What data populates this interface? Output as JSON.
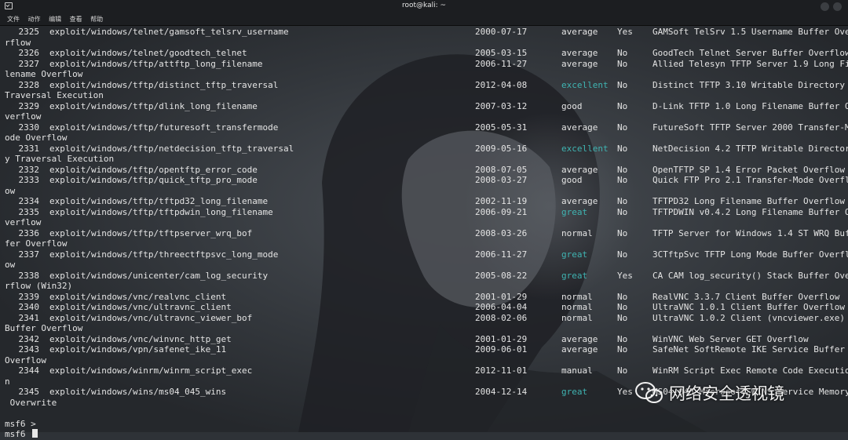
{
  "window": {
    "title": "root@kali: ~"
  },
  "menu": [
    "文件",
    "动作",
    "编辑",
    "查看",
    "帮助"
  ],
  "rows": [
    {
      "num": "2325",
      "path": "exploit/windows/telnet/gamsoft_telsrv_username",
      "date": "2000-07-17",
      "rank": "average",
      "check": "Yes",
      "desc": "GAMSoft TelSrv 1.5 Username Buffer Ove",
      "wrap": "rflow"
    },
    {
      "num": "2326",
      "path": "exploit/windows/telnet/goodtech_telnet",
      "date": "2005-03-15",
      "rank": "average",
      "check": "No",
      "desc": "GoodTech Telnet Server Buffer Overflow",
      "wrap": ""
    },
    {
      "num": "2327",
      "path": "exploit/windows/tftp/attftp_long_filename",
      "date": "2006-11-27",
      "rank": "average",
      "check": "No",
      "desc": "Allied Telesyn TFTP Server 1.9 Long Fi",
      "wrap": "lename Overflow"
    },
    {
      "num": "2328",
      "path": "exploit/windows/tftp/distinct_tftp_traversal",
      "date": "2012-04-08",
      "rank": "excellent",
      "check": "No",
      "desc": "Distinct TFTP 3.10 Writable Directory",
      "wrap": "Traversal Execution"
    },
    {
      "num": "2329",
      "path": "exploit/windows/tftp/dlink_long_filename",
      "date": "2007-03-12",
      "rank": "good",
      "check": "No",
      "desc": "D-Link TFTP 1.0 Long Filename Buffer O",
      "wrap": "verflow"
    },
    {
      "num": "2330",
      "path": "exploit/windows/tftp/futuresoft_transfermode",
      "date": "2005-05-31",
      "rank": "average",
      "check": "No",
      "desc": "FutureSoft TFTP Server 2000 Transfer-M",
      "wrap": "ode Overflow"
    },
    {
      "num": "2331",
      "path": "exploit/windows/tftp/netdecision_tftp_traversal",
      "date": "2009-05-16",
      "rank": "excellent",
      "check": "No",
      "desc": "NetDecision 4.2 TFTP Writable Director",
      "wrap": "y Traversal Execution"
    },
    {
      "num": "2332",
      "path": "exploit/windows/tftp/opentftp_error_code",
      "date": "2008-07-05",
      "rank": "average",
      "check": "No",
      "desc": "OpenTFTP SP 1.4 Error Packet Overflow",
      "wrap": ""
    },
    {
      "num": "2333",
      "path": "exploit/windows/tftp/quick_tftp_pro_mode",
      "date": "2008-03-27",
      "rank": "good",
      "check": "No",
      "desc": "Quick FTP Pro 2.1 Transfer-Mode Overfl",
      "wrap": "ow"
    },
    {
      "num": "2334",
      "path": "exploit/windows/tftp/tftpd32_long_filename",
      "date": "2002-11-19",
      "rank": "average",
      "check": "No",
      "desc": "TFTPD32 Long Filename Buffer Overflow",
      "wrap": ""
    },
    {
      "num": "2335",
      "path": "exploit/windows/tftp/tftpdwin_long_filename",
      "date": "2006-09-21",
      "rank": "great",
      "check": "No",
      "desc": "TFTPDWIN v0.4.2 Long Filename Buffer O",
      "wrap": "verflow"
    },
    {
      "num": "2336",
      "path": "exploit/windows/tftp/tftpserver_wrq_bof",
      "date": "2008-03-26",
      "rank": "normal",
      "check": "No",
      "desc": "TFTP Server for Windows 1.4 ST WRQ Buf",
      "wrap": "fer Overflow"
    },
    {
      "num": "2337",
      "path": "exploit/windows/tftp/threectftpsvc_long_mode",
      "date": "2006-11-27",
      "rank": "great",
      "check": "No",
      "desc": "3CTftpSvc TFTP Long Mode Buffer Overfl",
      "wrap": "ow"
    },
    {
      "num": "2338",
      "path": "exploit/windows/unicenter/cam_log_security",
      "date": "2005-08-22",
      "rank": "great",
      "check": "Yes",
      "desc": "CA CAM log_security() Stack Buffer Ove",
      "wrap": "rflow (Win32)"
    },
    {
      "num": "2339",
      "path": "exploit/windows/vnc/realvnc_client",
      "date": "2001-01-29",
      "rank": "normal",
      "check": "No",
      "desc": "RealVNC 3.3.7 Client Buffer Overflow",
      "wrap": ""
    },
    {
      "num": "2340",
      "path": "exploit/windows/vnc/ultravnc_client",
      "date": "2006-04-04",
      "rank": "normal",
      "check": "No",
      "desc": "UltraVNC 1.0.1 Client Buffer Overflow",
      "wrap": ""
    },
    {
      "num": "2341",
      "path": "exploit/windows/vnc/ultravnc_viewer_bof",
      "date": "2008-02-06",
      "rank": "normal",
      "check": "No",
      "desc": "UltraVNC 1.0.2 Client (vncviewer.exe)",
      "wrap": "Buffer Overflow"
    },
    {
      "num": "2342",
      "path": "exploit/windows/vnc/winvnc_http_get",
      "date": "2001-01-29",
      "rank": "average",
      "check": "No",
      "desc": "WinVNC Web Server GET Overflow",
      "wrap": ""
    },
    {
      "num": "2343",
      "path": "exploit/windows/vpn/safenet_ike_11",
      "date": "2009-06-01",
      "rank": "average",
      "check": "No",
      "desc": "SafeNet SoftRemote IKE Service Buffer",
      "wrap": "Overflow"
    },
    {
      "num": "2344",
      "path": "exploit/windows/winrm/winrm_script_exec",
      "date": "2012-11-01",
      "rank": "manual",
      "check": "No",
      "desc": "WinRM Script Exec Remote Code Executio",
      "wrap": "n"
    },
    {
      "num": "2345",
      "path": "exploit/windows/wins/ms04_045_wins",
      "date": "2004-12-14",
      "rank": "great",
      "check": "Yes",
      "desc": "MS04-045 Microsoft WINS Service Memory",
      "wrap": " Overwrite"
    }
  ],
  "prompt": {
    "line1": "msf6 >",
    "line2": "msf6 "
  },
  "watermark": {
    "text": "网络安全透视镜",
    "icon": "wechat-icon"
  },
  "colors": {
    "rank_highlight": "#3fb4b2",
    "background": "#2e3237"
  }
}
